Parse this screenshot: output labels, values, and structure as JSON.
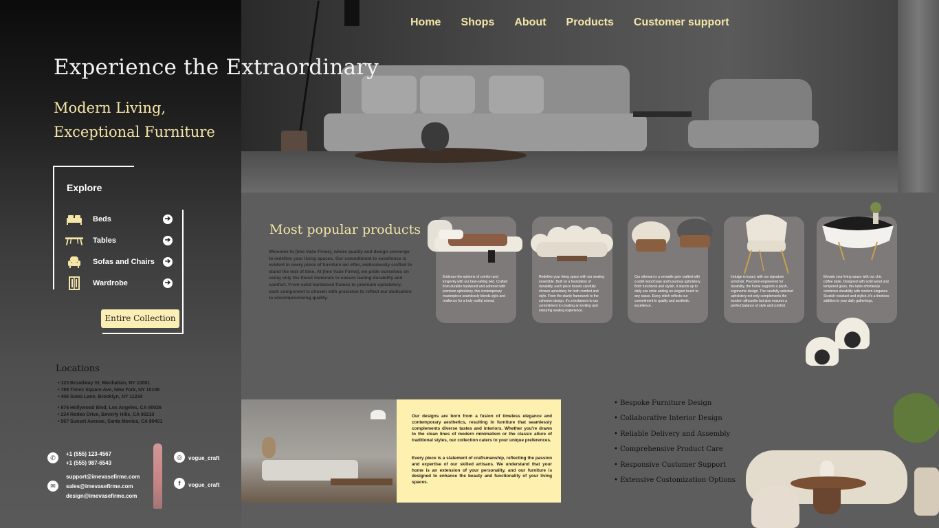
{
  "nav": {
    "items": [
      "Home",
      "Shops",
      "About",
      "Products",
      "Customer support"
    ]
  },
  "hero": {
    "title": "Experience the Extraordinary",
    "subtitle_line1": "Modern Living,",
    "subtitle_line2": "Exceptional Furniture"
  },
  "explore": {
    "title": "Explore",
    "items": [
      {
        "label": "Beds",
        "icon": "bed-icon"
      },
      {
        "label": "Tables",
        "icon": "table-icon"
      },
      {
        "label": "Sofas and Chairs",
        "icon": "armchair-icon"
      },
      {
        "label": "Wardrobe",
        "icon": "wardrobe-icon"
      }
    ],
    "button": "Entire Collection"
  },
  "locations": {
    "title": "Locations",
    "items": [
      "123 Broadway St, Manhattan, NY 10001",
      "789 Times Square Ave, New York, NY 10108",
      "456 SoHo Lane, Brooklyn, NY 11234",
      "876 Hollywood Blvd, Los Angeles, CA 90026",
      "234 Rodeo Drive, Beverly Hills, CA 90210",
      "567 Sunset Avenue, Santa Monica, CA 90401"
    ]
  },
  "contact": {
    "phone1": "+1 (555) 123-4567",
    "phone2": "+1 (555) 987-6543",
    "email1": "support@imevasefirme.com",
    "email2": "sales@imevasefirme.com",
    "email3": "design@imevasefirme.com",
    "instagram": "vogue_craft",
    "facebook": "vogue_craft"
  },
  "popular": {
    "title": "Most popular products",
    "description": "Welcome to [Ime Vaše Firme], where quality and design converge to redefine your living spaces. Our commitment to excellence is evident in every piece of furniture we offer, meticulously crafted to stand the test of time. At [Ime Vaše Firme], we pride ourselves on using only the finest materials to ensure lasting durability and comfort. From solid hardwood frames to premium upholstery, each component is chosen with precision to reflect our dedication to uncompromising quality.",
    "products": [
      {
        "text": "Embrace the epitome of comfort and longevity with our best-selling bed. Crafted from durable hardwood and adorned with premium upholstery, this contemporary masterpiece seamlessly blends style and resilience for a truly restful retreat."
      },
      {
        "text": "Redefine your living space with our seating ensemble. Built on a foundation of durability, each piece boasts carefully chosen upholstery for both comfort and style. From the sturdy framework to the cohesive design, it's a testament to our commitment to creating an inviting and enduring seating experience."
      },
      {
        "text": "Our ottoman is a versatile gem crafted with a solid wood base and luxurious upholstery. Both functional and stylish, it stands up to daily use while adding an elegant touch to any space. Every stitch reflects our commitment to quality and aesthetic excellence."
      },
      {
        "text": "Indulge in luxury with our signature armchair. Precision-engineered for durability, the frame supports a plush, ergonomic design. The carefully selected upholstery not only complements the modern silhouette but also ensures a perfect balance of style and comfort."
      },
      {
        "text": "Elevate your living space with our chic coffee table. Designed with solid wood and tempered glass, this table effortlessly combines durability with modern elegance. Scratch-resistant and stylish, it's a timeless addition to your daily gatherings."
      }
    ]
  },
  "about": {
    "paragraph1": "Our designs are born from a fusion of timeless elegance and contemporary aesthetics, resulting in furniture that seamlessly complements diverse tastes and interiors. Whether you're drawn to the clean lines of modern minimalism or the classic allure of traditional styles, our collection caters to your unique preferences.",
    "paragraph2": "Every piece is a statement of craftsmanship, reflecting the passion and expertise of our skilled artisans. We understand that your home is an extension of your personality, and our furniture is designed to enhance the beauty and functionality of your living spaces."
  },
  "services": [
    "Bespoke Furniture Design",
    "Collaborative Interior Design",
    "Reliable Delivery and Assembly",
    "Comprehensive Product Care",
    "Responsive Customer Support",
    "Extensive Customization Options"
  ],
  "colors": {
    "accent_yellow": "#f5e6a8",
    "button_bg": "#fbefb5",
    "yellow_panel": "#fef0ae",
    "card_bg": "#7d7a79",
    "page_bg": "#5d5d5d"
  }
}
